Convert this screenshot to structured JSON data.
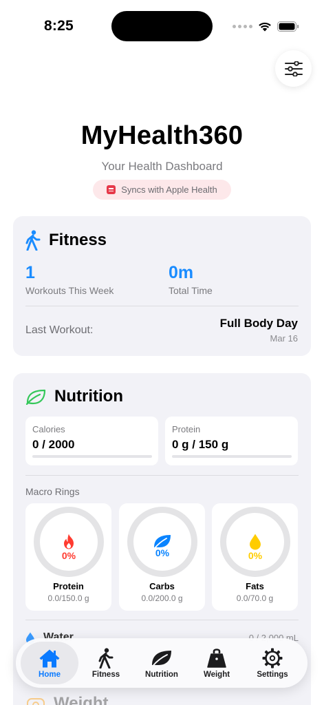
{
  "status_bar": {
    "time": "8:25"
  },
  "header": {
    "app_title": "MyHealth360",
    "subtitle": "Your Health Dashboard",
    "sync_badge": "Syncs with Apple Health"
  },
  "fitness": {
    "title": "Fitness",
    "workouts_value": "1",
    "workouts_label": "Workouts This Week",
    "time_value": "0m",
    "time_label": "Total Time",
    "last_workout_label": "Last Workout:",
    "last_workout_name": "Full Body Day",
    "last_workout_date": "Mar 16"
  },
  "nutrition": {
    "title": "Nutrition",
    "calories": {
      "label": "Calories",
      "value": "0 / 2000",
      "progress": 0
    },
    "protein": {
      "label": "Protein",
      "value": "0 g / 150 g",
      "progress": 0
    },
    "macro_rings_label": "Macro Rings",
    "rings": [
      {
        "name": "Protein",
        "percent": "0%",
        "detail": "0.0/150.0 g",
        "color": "#ff3b30",
        "icon": "flame-icon"
      },
      {
        "name": "Carbs",
        "percent": "0%",
        "detail": "0.0/200.0 g",
        "color": "#0a84ff",
        "icon": "leaf-icon"
      },
      {
        "name": "Fats",
        "percent": "0%",
        "detail": "0.0/70.0 g",
        "color": "#ffcc00",
        "icon": "drop-icon"
      }
    ],
    "water_label": "Water",
    "water_amount": "0 / 2,000 mL"
  },
  "weight_peek": {
    "title": "Weight"
  },
  "tabs": [
    {
      "label": "Home",
      "icon": "house-icon",
      "active": true
    },
    {
      "label": "Fitness",
      "icon": "walking-figure-icon",
      "active": false
    },
    {
      "label": "Nutrition",
      "icon": "leaf-icon",
      "active": false
    },
    {
      "label": "Weight",
      "icon": "kettlebell-icon",
      "active": false
    },
    {
      "label": "Settings",
      "icon": "gear-icon",
      "active": false
    }
  ],
  "colors": {
    "accent": "#0a7aff",
    "stat_blue": "#1a8cff",
    "card_bg": "#f2f2f7",
    "badge_bg": "#fde8ea",
    "nutrition_green": "#34c759"
  }
}
